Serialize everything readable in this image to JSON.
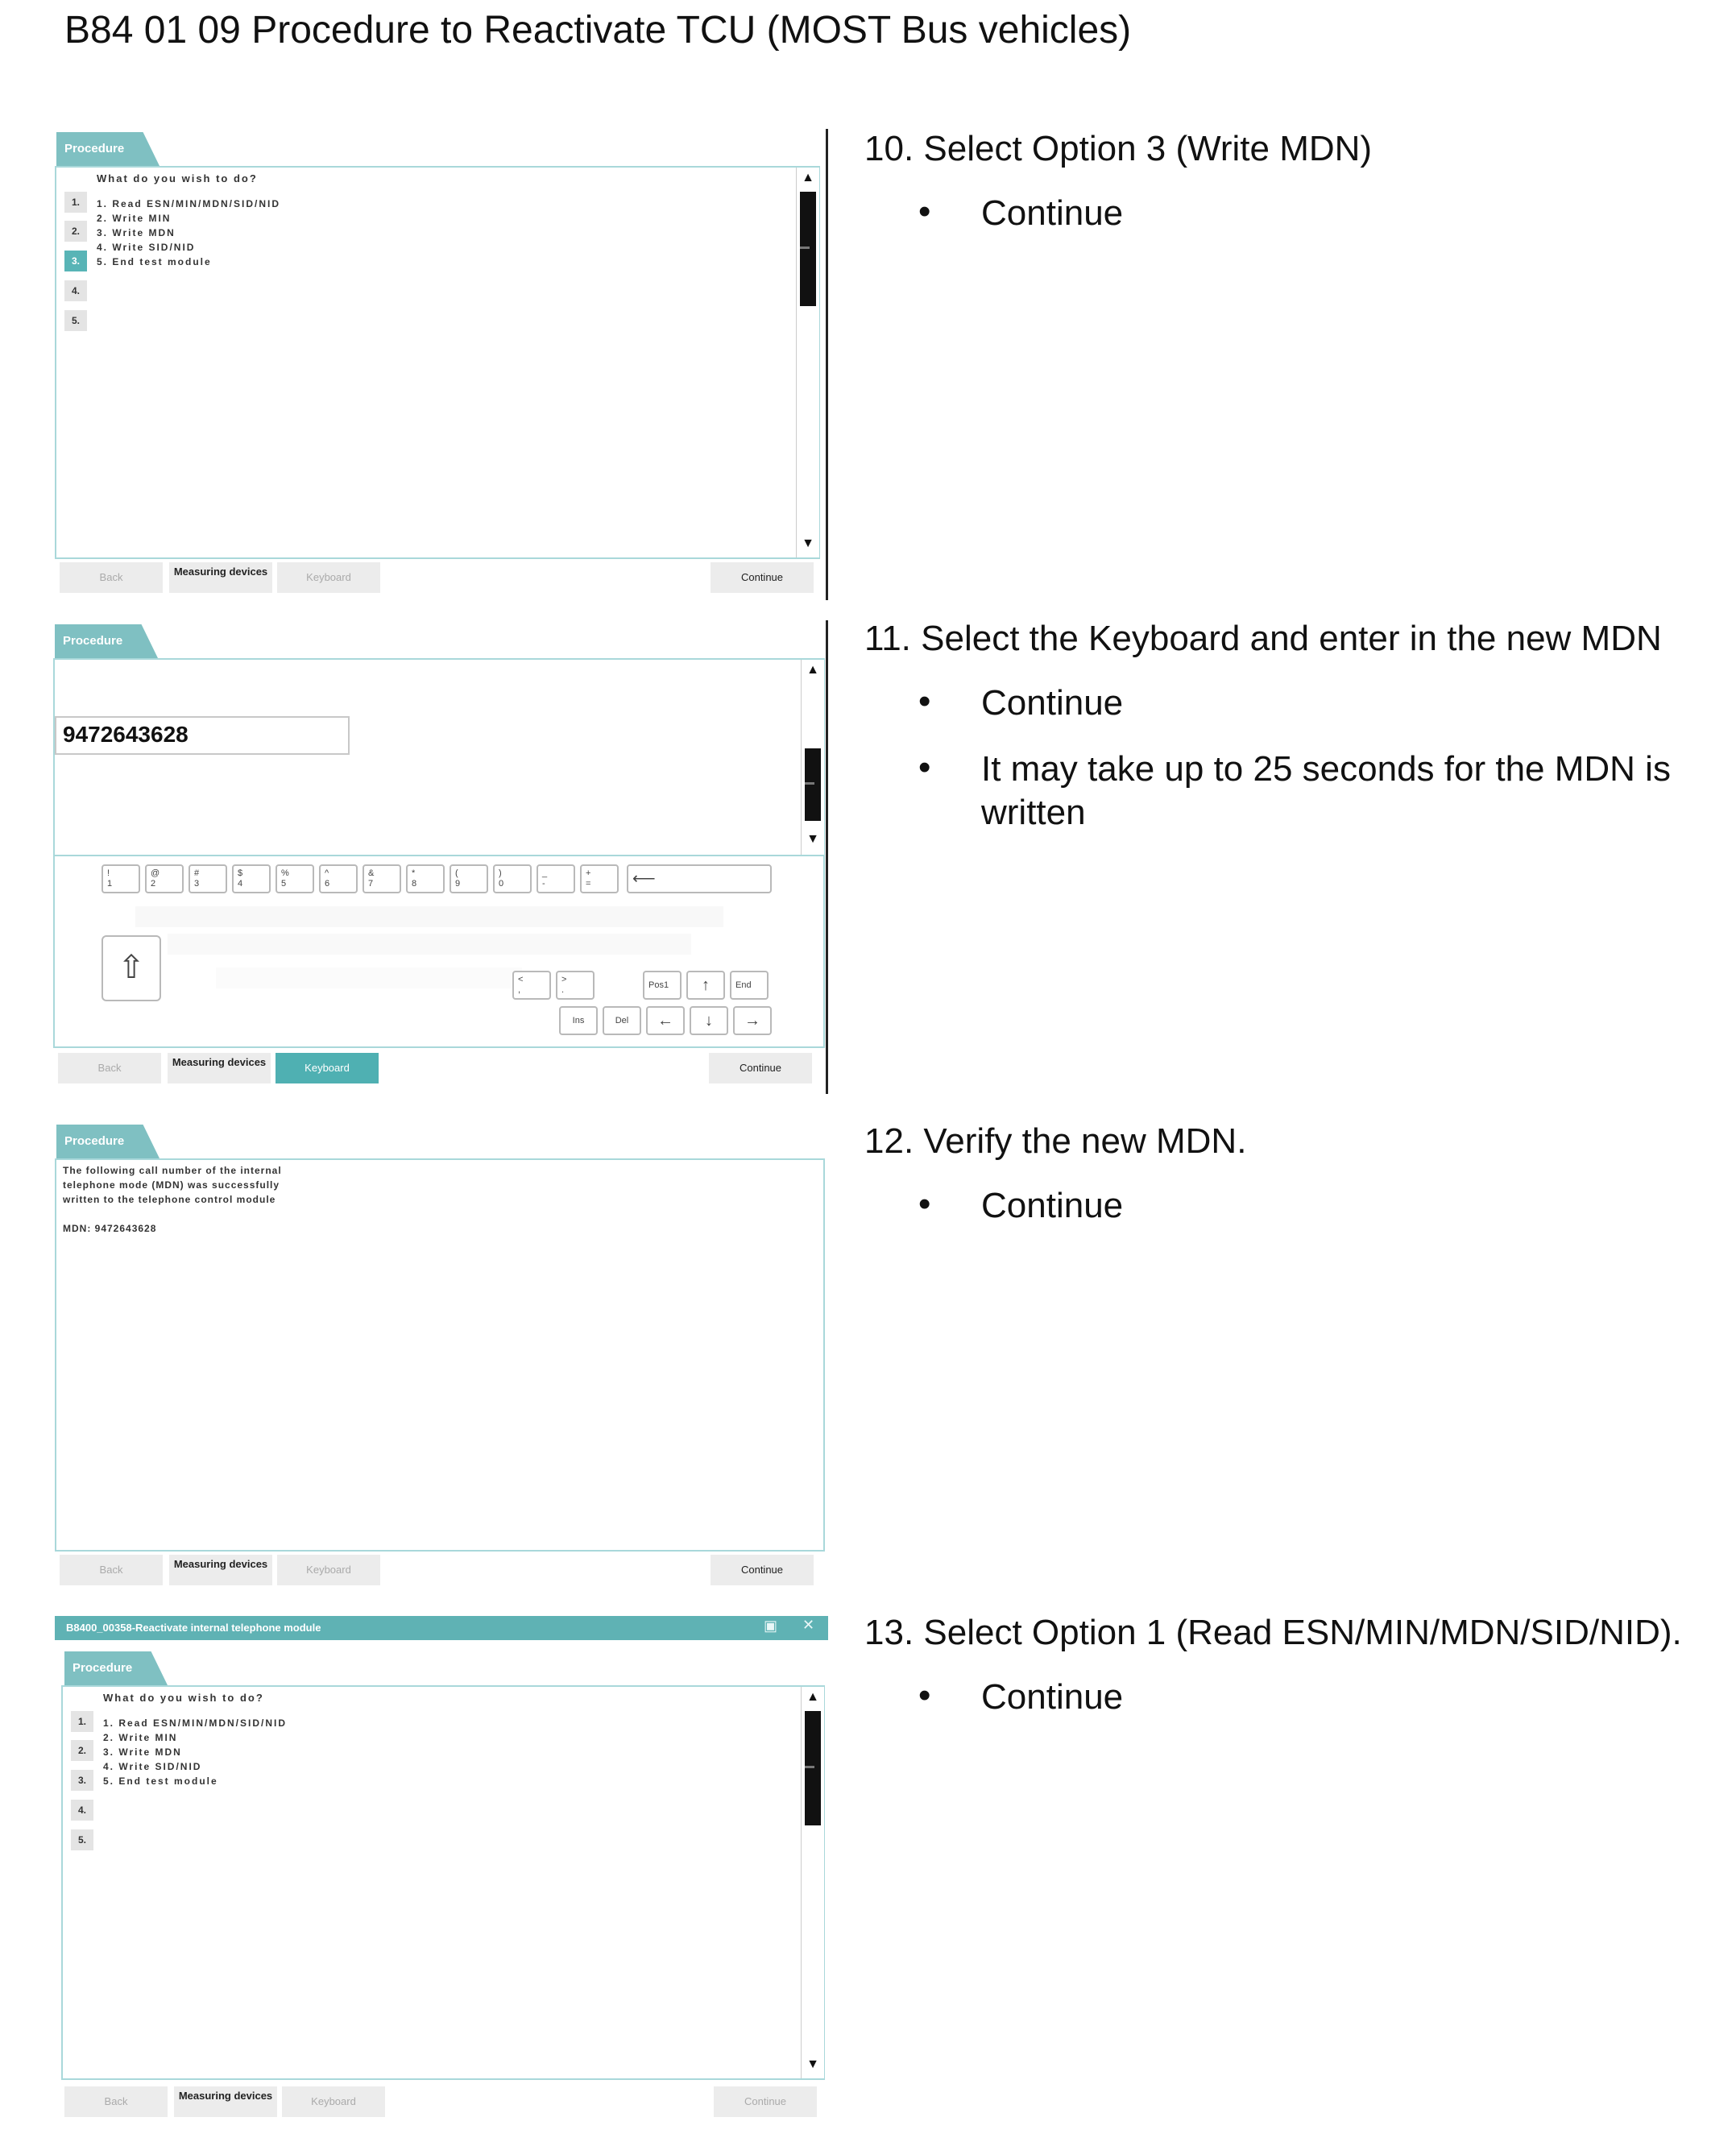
{
  "document": {
    "title": "B84 01 09 Procedure to Reactivate TCU (MOST Bus vehicles)"
  },
  "screens": {
    "common": {
      "procedure_tab": "Procedure",
      "back": "Back",
      "measuring": "Measuring devices",
      "keyboard": "Keyboard",
      "continue": "Continue"
    },
    "menu": {
      "question": "What do you wish to do?",
      "numbers": [
        "1.",
        "2.",
        "3.",
        "4.",
        "5."
      ],
      "options": [
        "1. Read ESN/MIN/MDN/SID/NID",
        "2. Write MIN",
        "3. Write MDN",
        "4. Write SID/NID",
        "5. End test module"
      ]
    },
    "keyboard_screen": {
      "mdn_value": "9472643628",
      "keys_top": [
        [
          "!",
          "1"
        ],
        [
          "@",
          "2"
        ],
        [
          "#",
          "3"
        ],
        [
          "$",
          "4"
        ],
        [
          "%",
          "5"
        ],
        [
          "^",
          "6"
        ],
        [
          "&",
          "7"
        ],
        [
          "*",
          "8"
        ],
        [
          "(",
          "9"
        ],
        [
          ")",
          "0"
        ],
        [
          "_",
          "-"
        ],
        [
          "+",
          "="
        ]
      ],
      "keys_bottom": {
        "lt": "<",
        "gt": ">",
        "pos1": "Pos1",
        "end": "End",
        "ins": "Ins",
        "del": "Del"
      }
    },
    "verify": {
      "line1": "The following call number of the internal",
      "line2": "telephone mode (MDN) was successfully",
      "line3": "written to the telephone control module",
      "mdn": "MDN: 9472643628"
    },
    "window_title": "B8400_00358-Reactivate internal telephone module"
  },
  "steps": {
    "s10": {
      "text": "10. Select Option 3 (Write MDN)",
      "bullets": [
        "Continue"
      ]
    },
    "s11": {
      "text": "11. Select the Keyboard and enter in the new MDN",
      "bullets": [
        "Continue",
        "It may take up to 25 seconds for the MDN is written"
      ]
    },
    "s12": {
      "text": "12. Verify the new MDN.",
      "bullets": [
        "Continue"
      ]
    },
    "s13": {
      "text": "13. Select Option 1 (Read ESN/MIN/MDN/SID/NID).",
      "bullets": [
        "Continue"
      ]
    }
  },
  "colors": {
    "accent": "#58b4b6",
    "tab": "#7fc0c2",
    "panel_border": "#a9d8da"
  }
}
